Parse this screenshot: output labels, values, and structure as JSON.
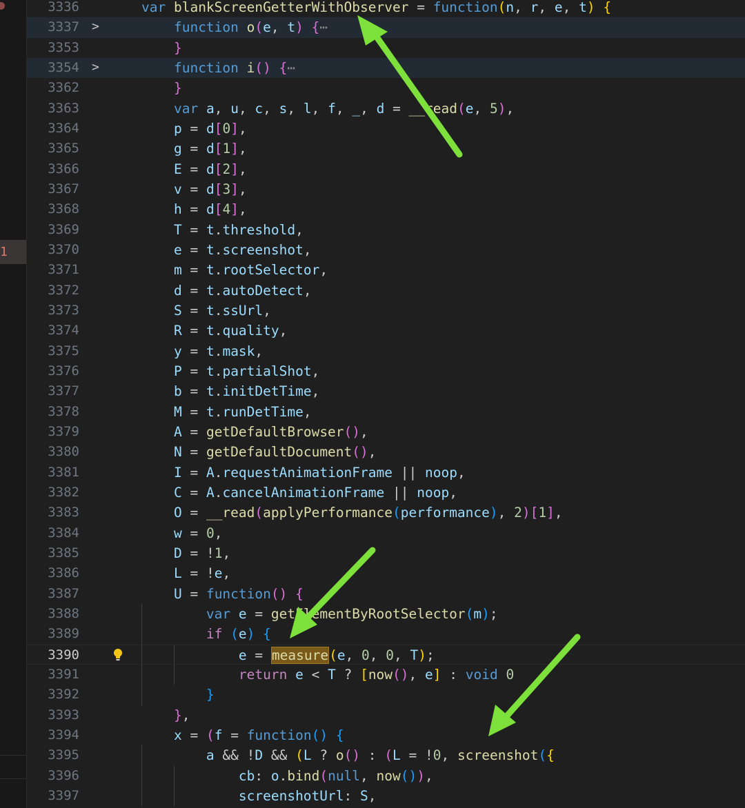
{
  "gutter": {
    "problem_count": "1"
  },
  "editor": {
    "fold_marker": ">",
    "ellipsis": "⋯",
    "lines": [
      {
        "n": "3336",
        "t": "var blankScreenGetterWithObserver = function(n, r, e, t) {"
      },
      {
        "n": "3337",
        "t": "function o(e, t) {⋯"
      },
      {
        "n": "3353",
        "t": "}"
      },
      {
        "n": "3354",
        "t": "function i() {⋯"
      },
      {
        "n": "3362",
        "t": "}"
      },
      {
        "n": "3363",
        "t": "var a, u, c, s, l, f, _, d = __read(e, 5),"
      },
      {
        "n": "3364",
        "t": "p = d[0],"
      },
      {
        "n": "3365",
        "t": "g = d[1],"
      },
      {
        "n": "3366",
        "t": "E = d[2],"
      },
      {
        "n": "3367",
        "t": "v = d[3],"
      },
      {
        "n": "3368",
        "t": "h = d[4],"
      },
      {
        "n": "3369",
        "t": "T = t.threshold,"
      },
      {
        "n": "3370",
        "t": "e = t.screenshot,"
      },
      {
        "n": "3371",
        "t": "m = t.rootSelector,"
      },
      {
        "n": "3372",
        "t": "d = t.autoDetect,"
      },
      {
        "n": "3373",
        "t": "S = t.ssUrl,"
      },
      {
        "n": "3374",
        "t": "R = t.quality,"
      },
      {
        "n": "3375",
        "t": "y = t.mask,"
      },
      {
        "n": "3376",
        "t": "P = t.partialShot,"
      },
      {
        "n": "3377",
        "t": "b = t.initDetTime,"
      },
      {
        "n": "3378",
        "t": "M = t.runDetTime,"
      },
      {
        "n": "3379",
        "t": "A = getDefaultBrowser(),"
      },
      {
        "n": "3380",
        "t": "N = getDefaultDocument(),"
      },
      {
        "n": "3381",
        "t": "I = A.requestAnimationFrame || noop,"
      },
      {
        "n": "3382",
        "t": "C = A.cancelAnimationFrame || noop,"
      },
      {
        "n": "3383",
        "t": "O = __read(applyPerformance(performance), 2)[1],"
      },
      {
        "n": "3384",
        "t": "w = 0,"
      },
      {
        "n": "3385",
        "t": "D = !1,"
      },
      {
        "n": "3386",
        "t": "L = !e,"
      },
      {
        "n": "3387",
        "t": "U = function() {"
      },
      {
        "n": "3388",
        "t": "var e = getElementByRootSelector(m);"
      },
      {
        "n": "3389",
        "t": "if (e) {"
      },
      {
        "n": "3390",
        "t": "e = measure(e, 0, 0, T);"
      },
      {
        "n": "3391",
        "t": "return e < T ? [now(), e] : void 0"
      },
      {
        "n": "3392",
        "t": "}"
      },
      {
        "n": "3393",
        "t": "},"
      },
      {
        "n": "3394",
        "t": "x = (f = function() {"
      },
      {
        "n": "3395",
        "t": "a && !D && (L ? o() : (L = !0, screenshot({"
      },
      {
        "n": "3396",
        "t": "cb: o.bind(null, now()),"
      },
      {
        "n": "3397",
        "t": "screenshotUrl: S,"
      }
    ]
  },
  "colors": {
    "arrow": "#7ee03a",
    "highlight_word": "#7a5a18"
  }
}
